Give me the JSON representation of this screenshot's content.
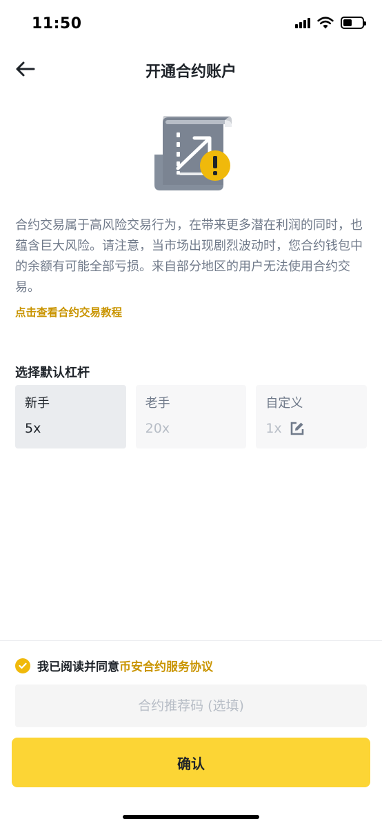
{
  "status_bar": {
    "time": "11:50",
    "icons": [
      "cellular-signal-icon",
      "wifi-icon",
      "battery-icon"
    ],
    "battery_level": 0.45
  },
  "nav": {
    "back_icon": "arrow-left-icon",
    "title": "开通合约账户"
  },
  "illustration": {
    "icon": "futures-document-warning-icon"
  },
  "description": "合约交易属于高风险交易行为，在带来更多潜在利润的同时，也蕴含巨大风险。请注意，当市场出现剧烈波动时，您合约钱包中的余额有可能全部亏损。来自部分地区的用户无法使用合约交易。",
  "tutorial_link": "点击查看合约交易教程",
  "leverage": {
    "label": "选择默认杠杆",
    "options": [
      {
        "name": "新手",
        "value": "5x",
        "selected": true
      },
      {
        "name": "老手",
        "value": "20x",
        "selected": false
      },
      {
        "name": "自定义",
        "value": "1x",
        "selected": false,
        "icon": "edit-icon"
      }
    ]
  },
  "agreement": {
    "checked": true,
    "text": "我已阅读并同意",
    "link": "币安合约服务协议"
  },
  "referral": {
    "value": "",
    "placeholder": "合约推荐码 (选填)"
  },
  "confirm_label": "确认",
  "colors": {
    "brand_yellow": "#FCD535",
    "link_gold": "#C99400",
    "check_yellow": "#F0B90B",
    "text_primary": "#1E2329",
    "text_secondary": "#707A8A",
    "text_disabled": "#B7BDC6"
  }
}
